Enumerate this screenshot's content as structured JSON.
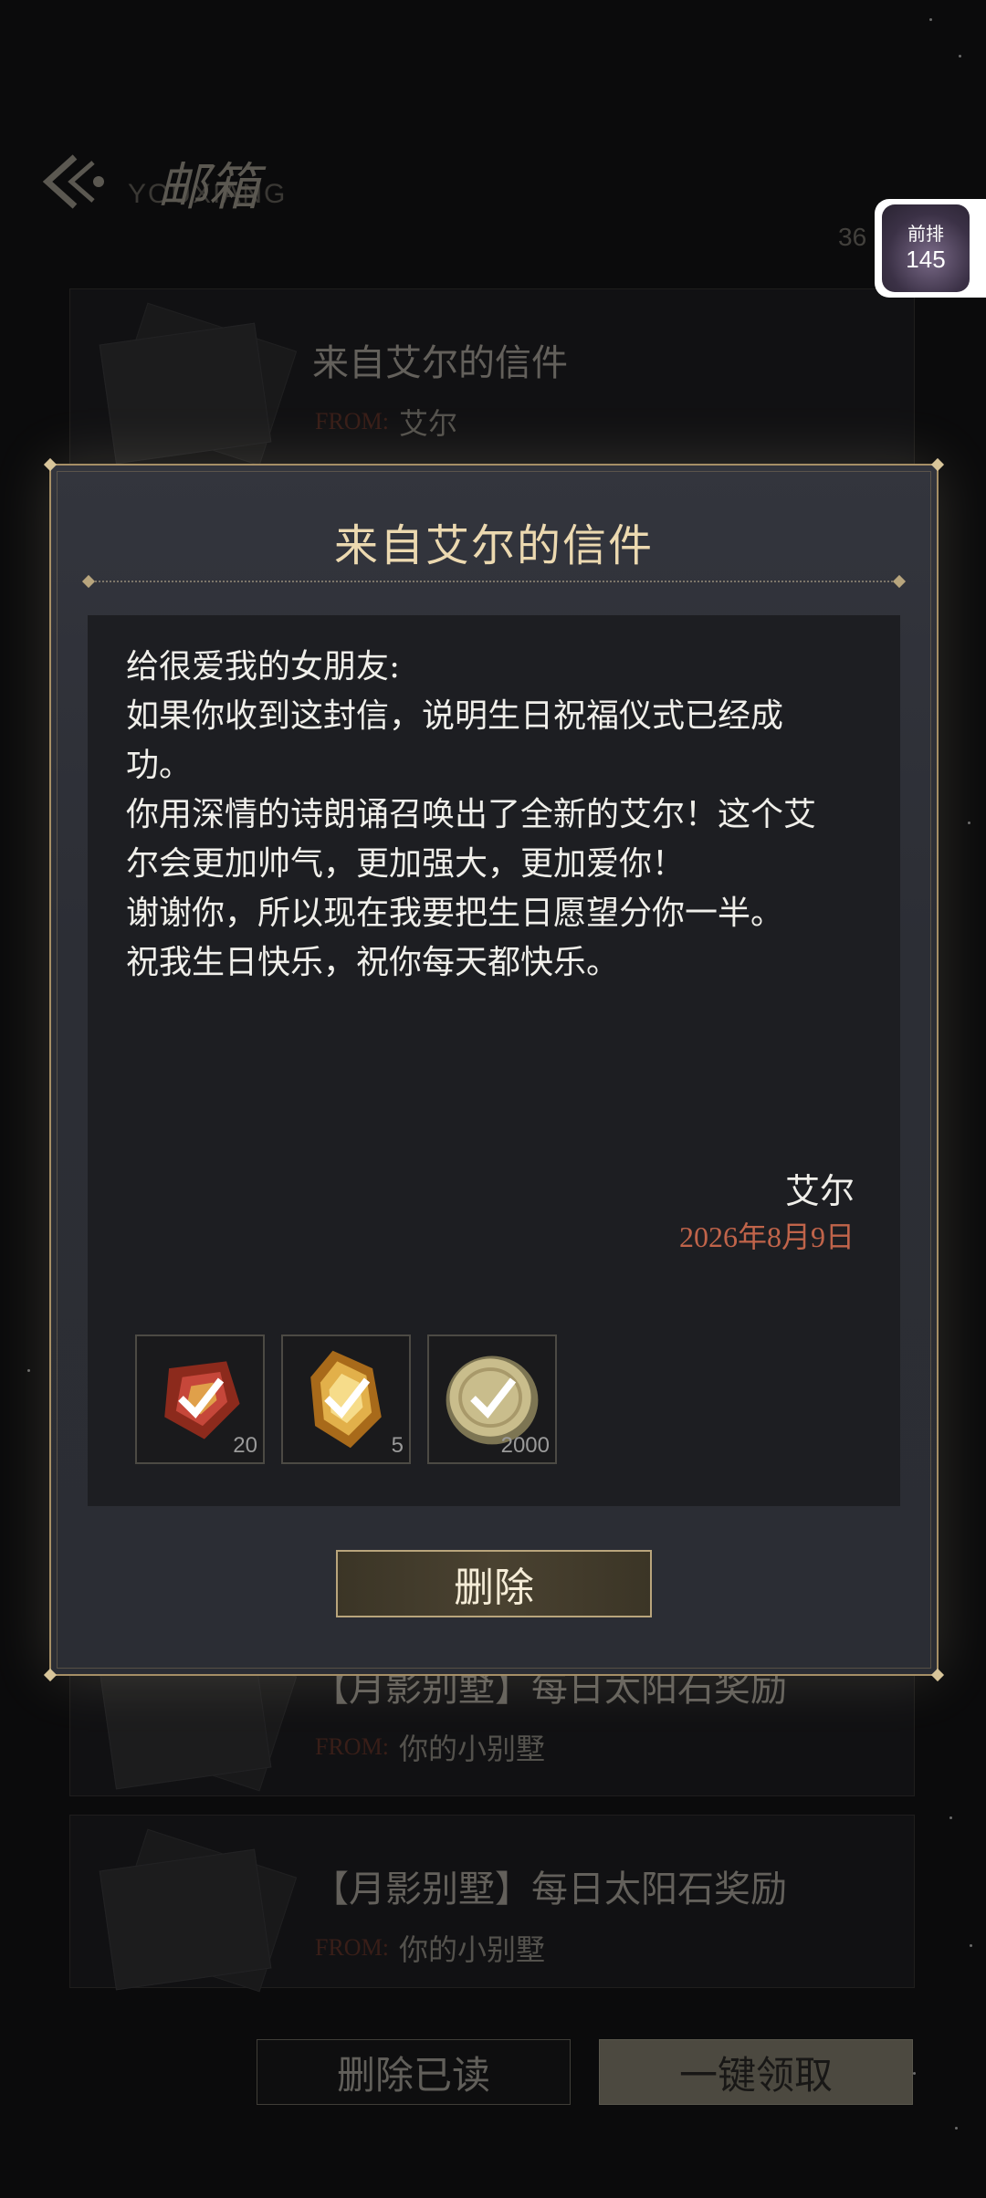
{
  "header": {
    "title": "邮箱",
    "subtitle": "YOUXIANG",
    "count": "36"
  },
  "mail_list": [
    {
      "title": "来自艾尔的信件",
      "from_label": "FROM:",
      "sender": "艾尔"
    },
    {
      "title": "【月影别墅】每日太阳石奖励",
      "from_label": "FROM:",
      "sender": "你的小别墅"
    },
    {
      "title": "【月影别墅】每日太阳石奖励",
      "from_label": "FROM:",
      "sender": "你的小别墅"
    }
  ],
  "buttons": {
    "delete_read": "删除已读",
    "claim_all": "一键领取"
  },
  "avatar_badge": {
    "label": "前排",
    "number": "145"
  },
  "dialog": {
    "title": "来自艾尔的信件",
    "body": "给很爱我的女朋友:\n如果你收到这封信，说明生日祝福仪式已经成功。\n你用深情的诗朗诵召唤出了全新的艾尔！这个艾尔会更加帅气，更加强大，更加爱你！\n谢谢你，所以现在我要把生日愿望分你一半。\n祝我生日快乐，祝你每天都快乐。",
    "signer": "艾尔",
    "date": "2026年8月9日",
    "rewards": [
      {
        "icon": "red-gem-icon",
        "qty": "20",
        "claimed": true
      },
      {
        "icon": "gold-crystal-icon",
        "qty": "5",
        "claimed": true
      },
      {
        "icon": "gold-coin-icon",
        "qty": "2000",
        "claimed": true
      }
    ],
    "delete_label": "删除"
  },
  "colors": {
    "accent_gold": "#a68f66",
    "date_red": "#c0644a",
    "letter_bg": "#1d1e22"
  }
}
